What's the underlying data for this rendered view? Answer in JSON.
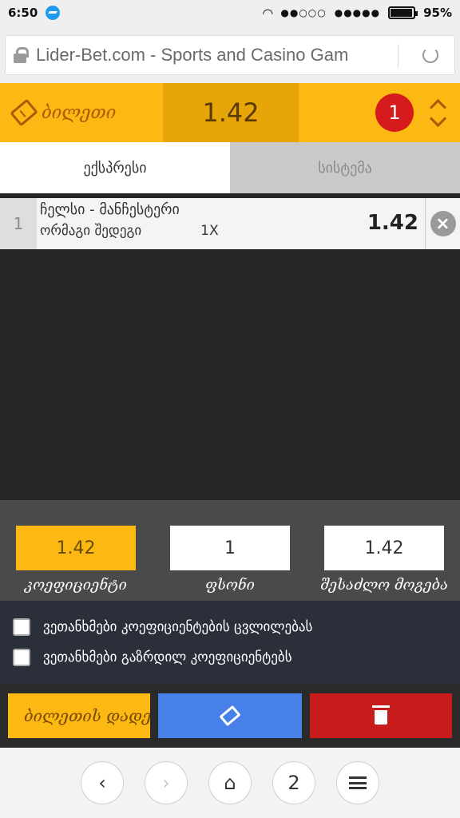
{
  "status_bar": {
    "time": "6:50",
    "signal_dots": "●●○○○",
    "signal_dots2": "●●●●●",
    "battery": "95%",
    "battery_level": 0.95
  },
  "browser": {
    "url": "Lider-Bet.com - Sports and Casino Gam"
  },
  "ticket_header": {
    "title": "ბილეთი",
    "odds": "1.42",
    "count": "1"
  },
  "tabs": [
    {
      "label": "ექსპრესი",
      "active": true
    },
    {
      "label": "სისტემა",
      "active": false
    }
  ],
  "bets": [
    {
      "number": "1",
      "match": "ჩელსი - მანჩესტერი",
      "market": "ორმაგი შედეგი",
      "selection": "1X",
      "odd": "1.42"
    }
  ],
  "summary": {
    "coefficient_value": "1.42",
    "coefficient_label": "კოეფიციენტი",
    "stake_value": "1",
    "stake_label": "ფსონი",
    "win_value": "1.42",
    "win_label": "შესაძლო მოგება"
  },
  "options": [
    {
      "label": "ვეთანხმები კოეფიციენტების ცვლილებას",
      "checked": false
    },
    {
      "label": "ვეთანხმები გაზრდილ კოეფიციენტებს",
      "checked": false
    }
  ],
  "actions": {
    "place_label": "ბილეთის დადება"
  },
  "nav": {
    "tabs_count": "2"
  },
  "colors": {
    "accent_yellow": "#fdb913",
    "dark_yellow": "#e6a509",
    "badge_red": "#d51b1b",
    "blue": "#4680e8",
    "delete_red": "#c81b1b"
  }
}
